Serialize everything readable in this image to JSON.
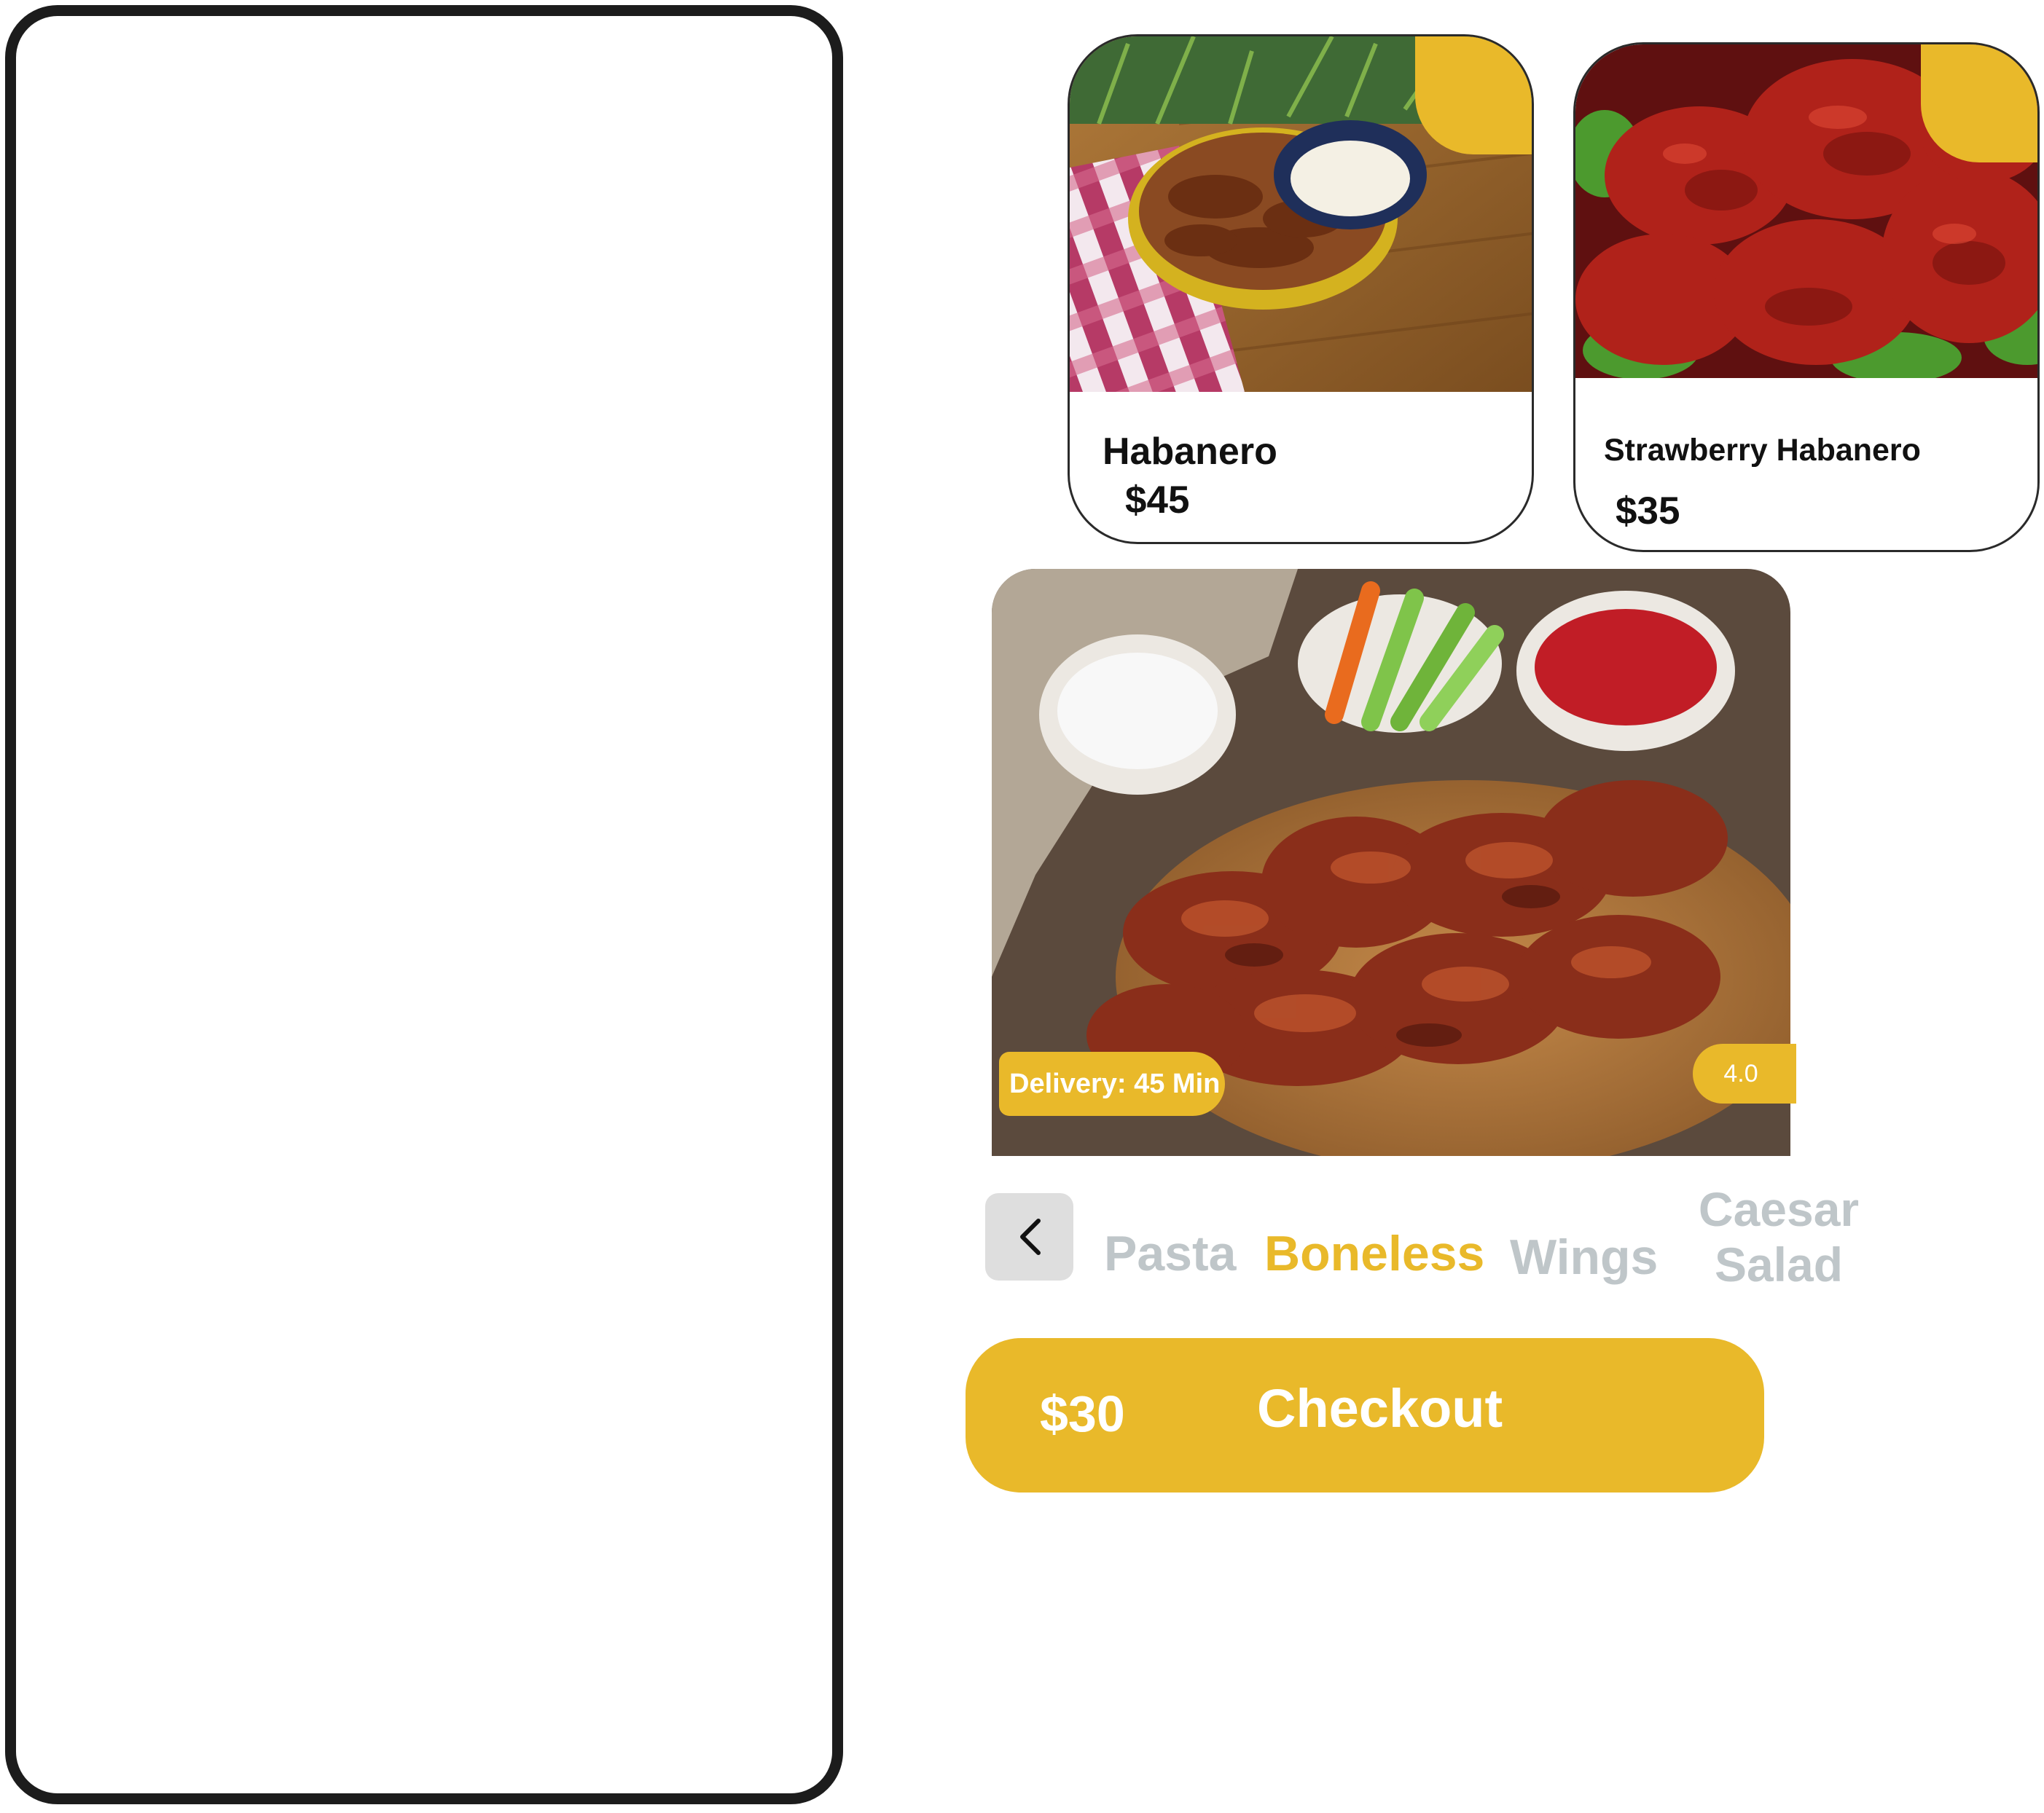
{
  "colors": {
    "accent": "#e9b92a",
    "inactive_category": "#bfc6c9",
    "frame": "#1c1c1c",
    "back_button_bg": "#dedede"
  },
  "cards": [
    {
      "title": "Habanero",
      "price": "$45",
      "photo": "wings-with-ranch-dip-photo"
    },
    {
      "title": "Strawberry Habanero",
      "price": "$35",
      "photo": "glazed-red-wings-photo"
    }
  ],
  "hero": {
    "photo": "wings-platter-with-dips-photo",
    "delivery": "Delivery: 45 Min",
    "rating": "4.0"
  },
  "categories": {
    "back_icon": "chevron-left-icon",
    "items": [
      "Pasta",
      "Boneless",
      "Wings",
      "Caesar Salad"
    ],
    "selected": "Boneless"
  },
  "checkout": {
    "total": "$30",
    "label": "Checkout"
  }
}
